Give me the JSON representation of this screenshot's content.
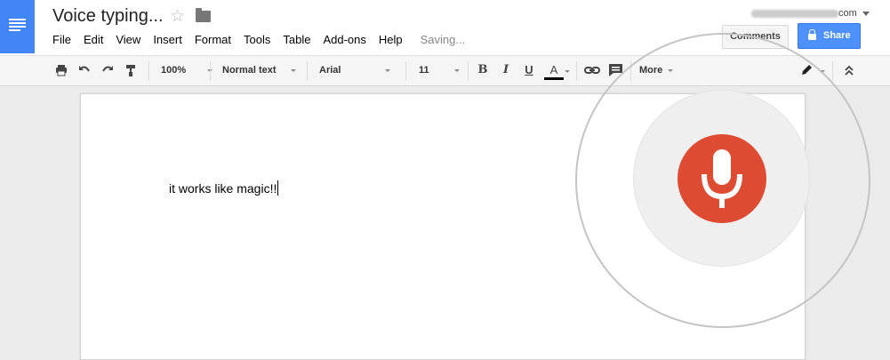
{
  "app": {
    "title": "Voice typing...",
    "status": "Saving..."
  },
  "menu": [
    "File",
    "Edit",
    "View",
    "Insert",
    "Format",
    "Tools",
    "Table",
    "Add-ons",
    "Help"
  ],
  "account": {
    "email_suffix": "com"
  },
  "buttons": {
    "comments": "Comments",
    "share": "Share"
  },
  "toolbar": {
    "zoom": "100%",
    "style": "Normal text",
    "font": "Arial",
    "size": "11",
    "bold": "B",
    "italic": "I",
    "underline": "U",
    "text_color": "A",
    "more": "More"
  },
  "icons": [
    "docs-logo-icon",
    "star-icon",
    "folder-icon",
    "print-icon",
    "undo-icon",
    "redo-icon",
    "paint-format-icon",
    "link-icon",
    "comment-icon",
    "pencil-icon",
    "collapse-icon",
    "microphone-icon"
  ],
  "colors": {
    "brand": "#4285f4",
    "share": "#4d90fe",
    "mic": "#dd4b32"
  },
  "document": {
    "text": "it works like magic!!"
  }
}
